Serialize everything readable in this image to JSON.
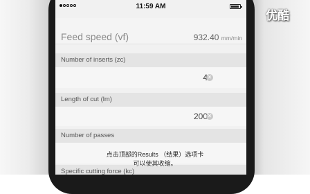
{
  "status_bar": {
    "time": "11:59 AM"
  },
  "feed_speed": {
    "label": "Feed speed (vf)",
    "value": "932.40",
    "unit": "mm/min"
  },
  "fields": [
    {
      "label": "Number of inserts (zc)",
      "value": "4"
    },
    {
      "label": "Length of cut (lm)",
      "value": "200"
    },
    {
      "label": "Number of passes",
      "value": ""
    },
    {
      "label": "Specific cutting force (kc)",
      "value": ""
    }
  ],
  "subtitles": {
    "line1": "点击顶部的Results （结果）选项卡",
    "line2": "可以使其收缩。"
  },
  "watermark": {
    "logo_text": "优酷"
  },
  "icons": {
    "signal": "signal-dots-icon",
    "battery": "battery-icon",
    "clear": "clear-x-icon"
  }
}
